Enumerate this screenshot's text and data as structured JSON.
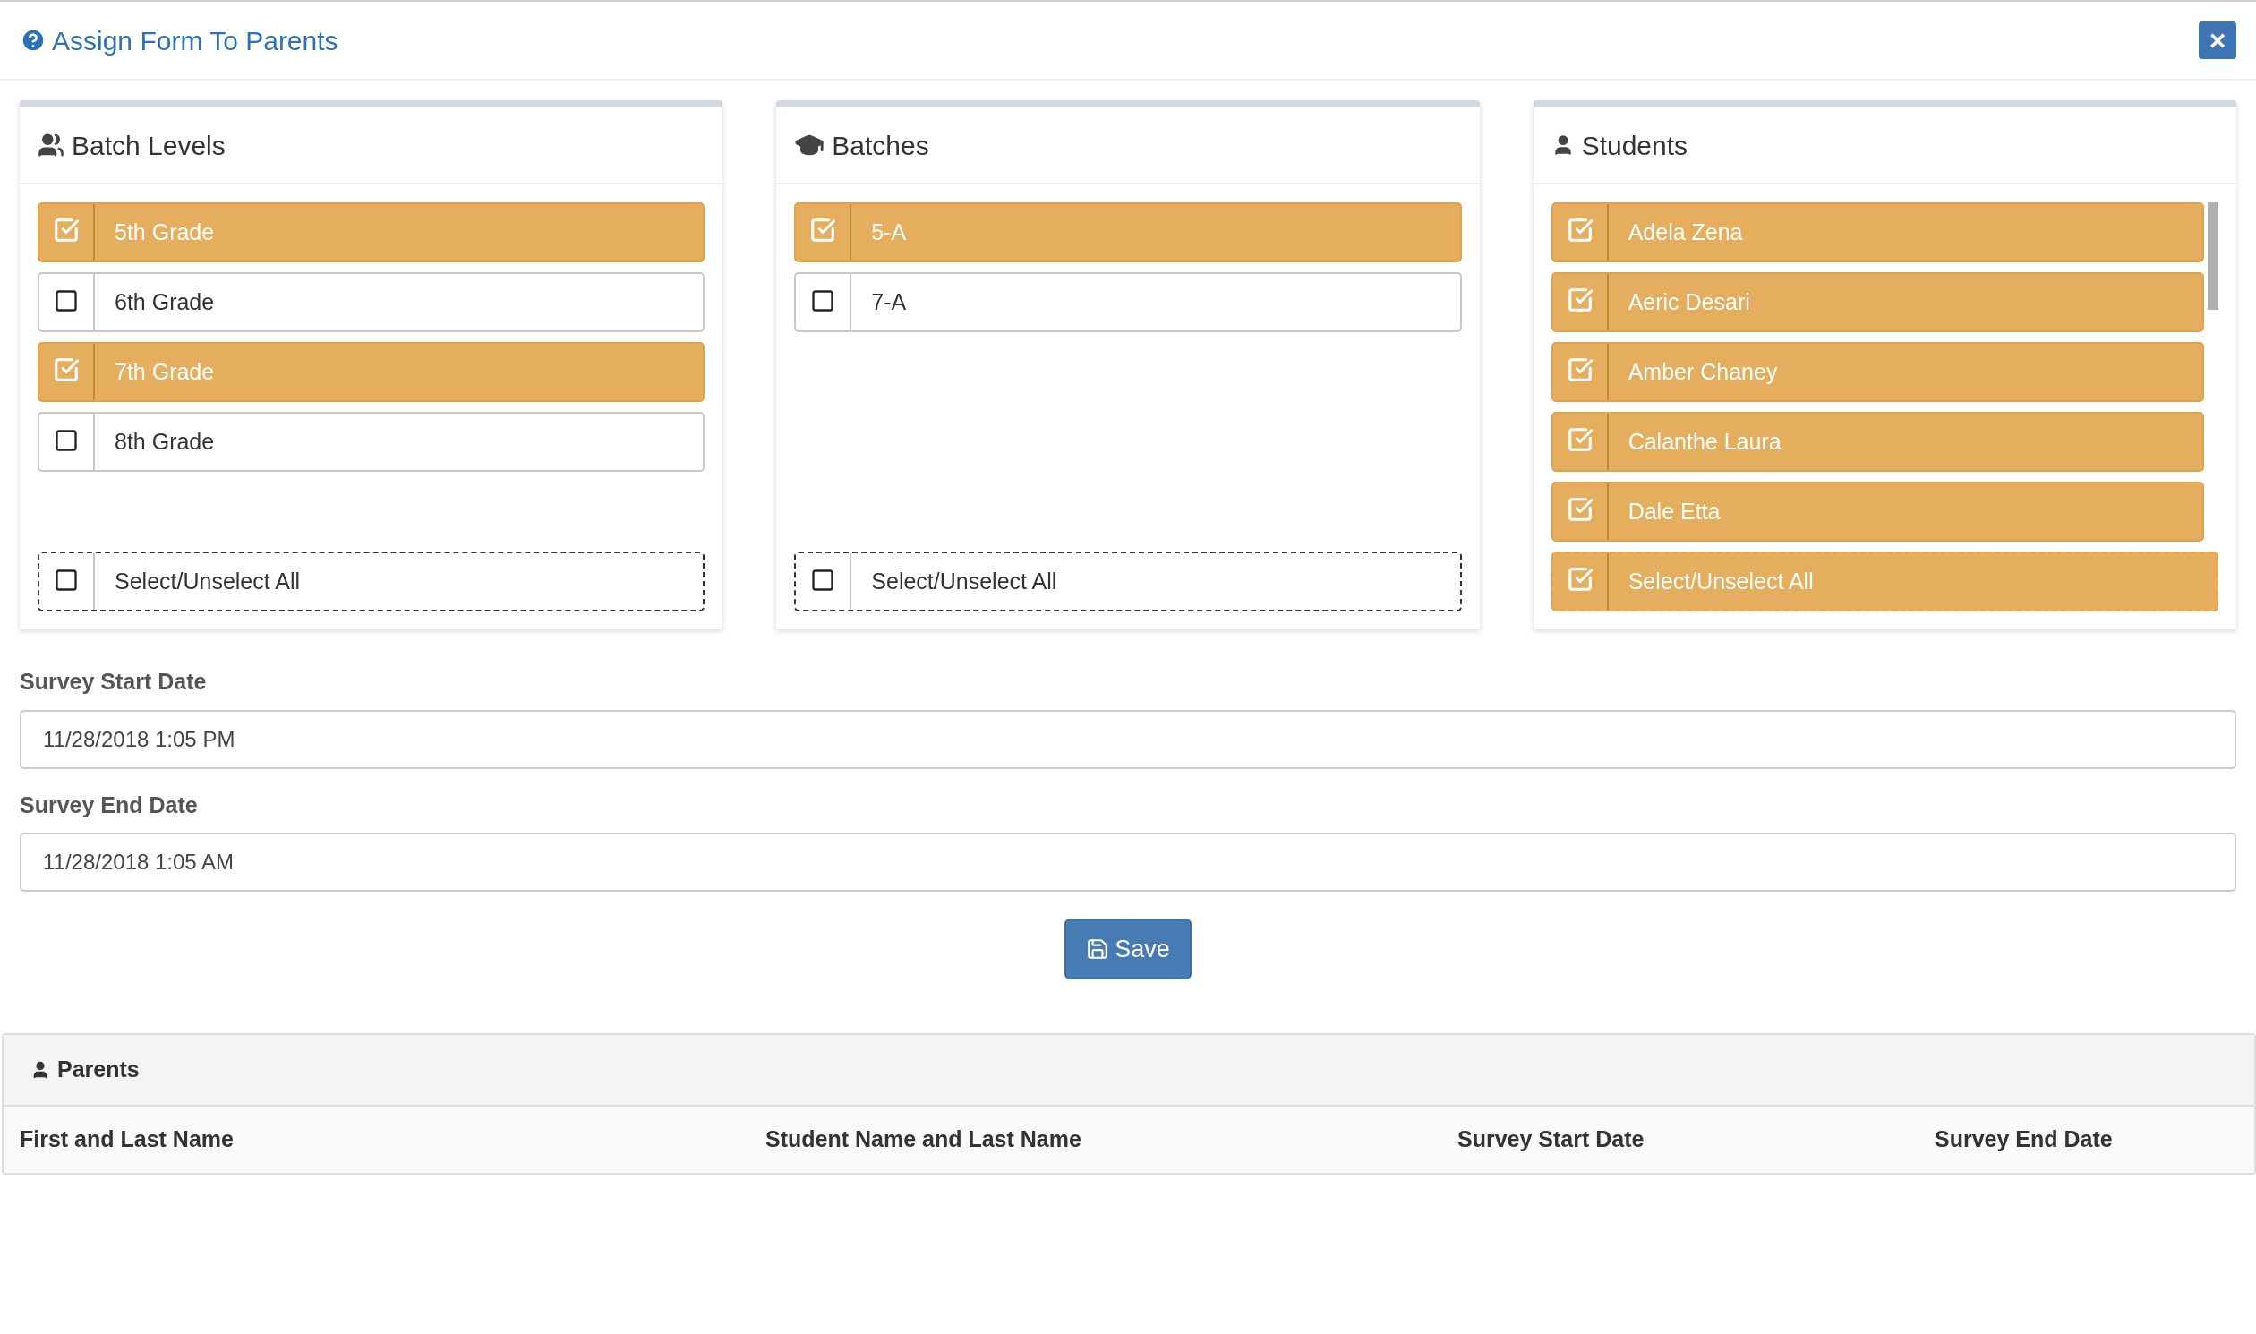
{
  "dialog": {
    "title": "Assign Form To Parents",
    "close_label": "×"
  },
  "panels": [
    {
      "title": "Batch Levels",
      "kind": "users",
      "items": [
        {
          "label": "5th Grade",
          "checked": true
        },
        {
          "label": "6th Grade",
          "checked": false
        },
        {
          "label": "7th Grade",
          "checked": true
        },
        {
          "label": "8th Grade",
          "checked": false
        }
      ],
      "select_all": {
        "label": "Select/Unselect All",
        "checked": false
      }
    },
    {
      "title": "Batches",
      "kind": "graduation",
      "items": [
        {
          "label": "5-A",
          "checked": true
        },
        {
          "label": "7-A",
          "checked": false
        }
      ],
      "select_all": {
        "label": "Select/Unselect All",
        "checked": false
      }
    },
    {
      "title": "Students",
      "kind": "user",
      "items": [
        {
          "label": "Adela Zena",
          "checked": true
        },
        {
          "label": "Aeric Desari",
          "checked": true
        },
        {
          "label": "Amber Chaney",
          "checked": true
        },
        {
          "label": "Calanthe Laura",
          "checked": true
        },
        {
          "label": "Dale Etta",
          "checked": true
        }
      ],
      "select_all": {
        "label": "Select/Unselect All",
        "checked": true
      }
    }
  ],
  "fields": [
    {
      "label": "Survey Start Date",
      "value": "11/28/2018 1:05 PM"
    },
    {
      "label": "Survey End Date",
      "value": "11/28/2018 1:05 AM"
    }
  ],
  "save_button": {
    "label": "Save"
  },
  "parents": {
    "title": "Parents",
    "columns": [
      "First and Last Name",
      "Student Name and Last Name",
      "Survey Start Date",
      "Survey End Date"
    ]
  }
}
